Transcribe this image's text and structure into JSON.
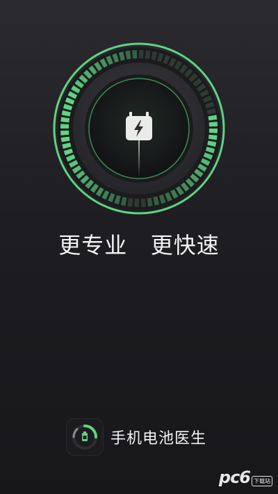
{
  "splash": {
    "slogan": "更专业   更快速",
    "app_name": "手机电池医生",
    "watermark_main": "pc6",
    "watermark_sub": "下载站"
  },
  "colors": {
    "accent": "#5fd483",
    "background": "#1e1e22",
    "text": "#f4f4f4"
  },
  "icons": {
    "center": "charging-battery-icon",
    "app_logo": "battery-doctor-logo-icon"
  }
}
